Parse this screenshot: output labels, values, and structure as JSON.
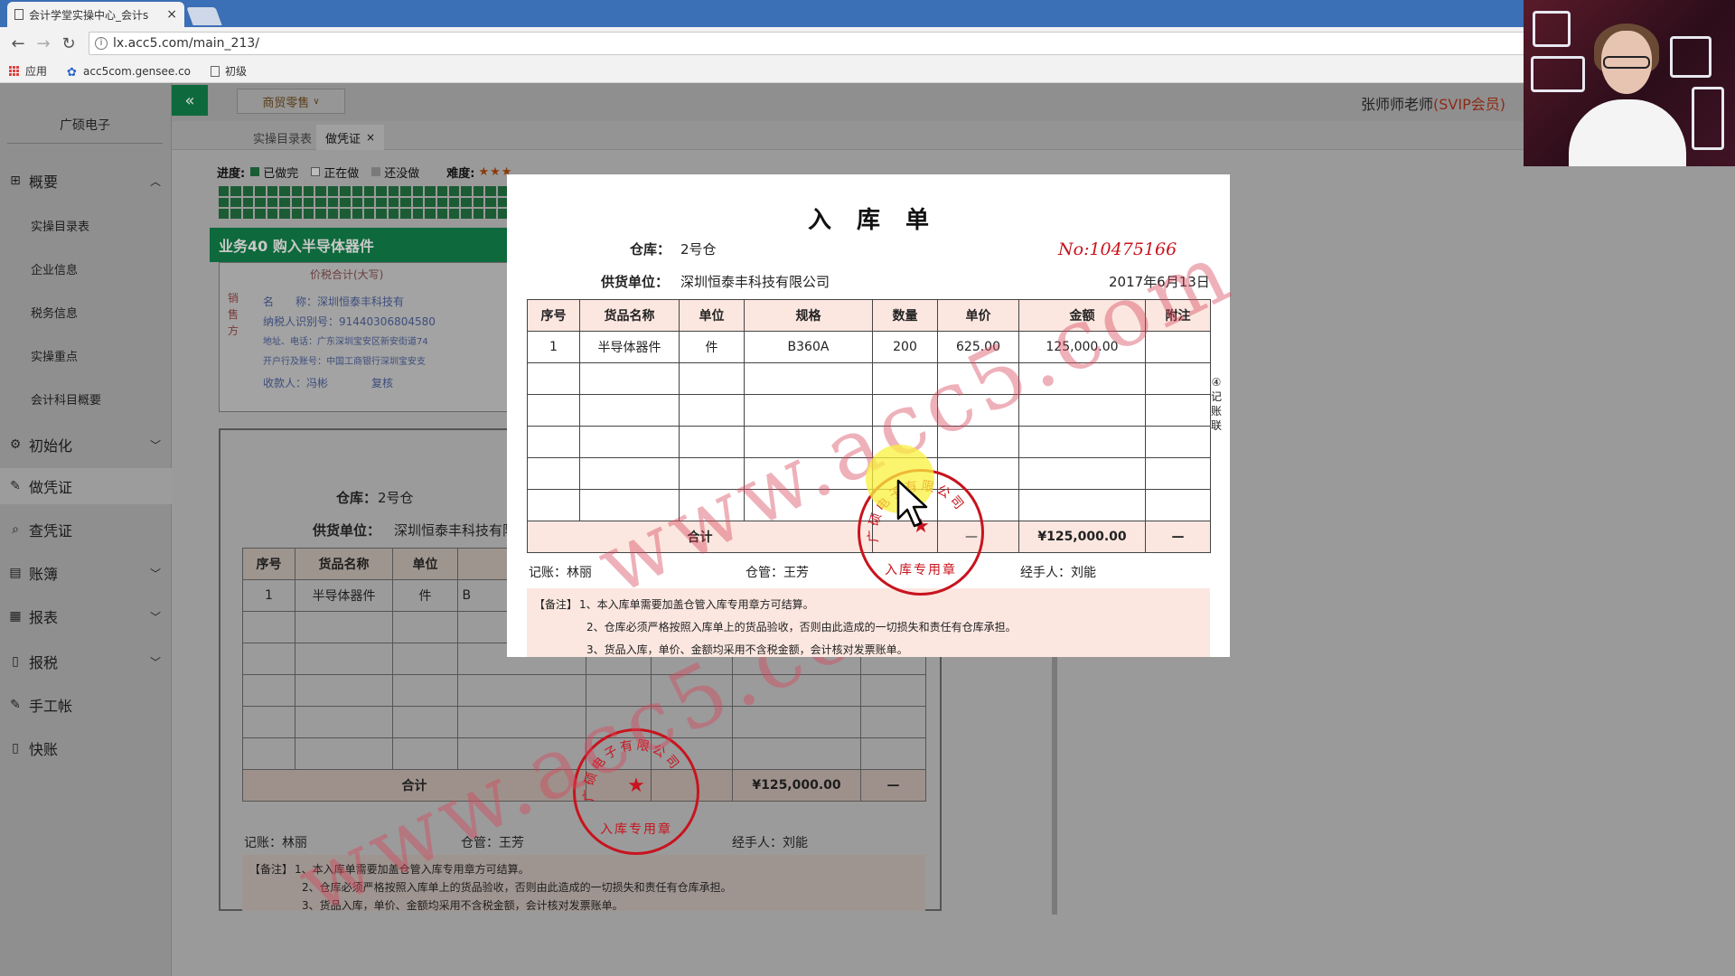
{
  "browser": {
    "tab_title": "会计学堂实操中心_会计s",
    "tab_close": "×",
    "url": "lx.acc5.com/main_213/",
    "bookmarks": [
      "应用",
      "acc5com.gensee.co",
      "初级"
    ]
  },
  "header": {
    "collapse_glyph": "«",
    "industry_select": "商贸零售",
    "teacher_name": "张师师老师",
    "teacher_badge": "(SVIP会员)"
  },
  "sidebar": {
    "company": "广硕电子",
    "items": [
      {
        "label": "概要",
        "icon": "grid-icon",
        "chevron": "up"
      },
      {
        "label": "初始化",
        "icon": "gear-icon",
        "chevron": "down"
      },
      {
        "label": "做凭证",
        "icon": "pen-icon",
        "chevron": ""
      },
      {
        "label": "查凭证",
        "icon": "search-icon",
        "chevron": ""
      },
      {
        "label": "账簿",
        "icon": "book-icon",
        "chevron": "down"
      },
      {
        "label": "报表",
        "icon": "report-icon",
        "chevron": "down"
      },
      {
        "label": "报税",
        "icon": "file-icon",
        "chevron": "down"
      },
      {
        "label": "手工帐",
        "icon": "pen-icon",
        "chevron": ""
      },
      {
        "label": "快账",
        "icon": "file-icon",
        "chevron": ""
      }
    ],
    "sub_items": [
      "实操目录表",
      "企业信息",
      "税务信息",
      "实操重点",
      "会计科目概要"
    ]
  },
  "page_tabs": [
    {
      "label": "实操目录表"
    },
    {
      "label": "做凭证",
      "close": "×"
    }
  ],
  "progress": {
    "label": "进度:",
    "legend_done": "已做完",
    "legend_doing": "正在做",
    "legend_todo": "还没做",
    "difficulty_label": "难度:",
    "difficulty_stars": "★★★"
  },
  "task": {
    "title": "业务40 购入半导体器件"
  },
  "invoice_fragment": {
    "title": "价税合计(大写)",
    "side_label": "销售方",
    "lines": [
      "名　　称：深圳恒泰丰科技有",
      "纳税人识别号：914403068045​80",
      "地址、电话：广东深圳宝安区新安街道74",
      "开户行及账号：中国工商银行深圳宝安支",
      "收款人：冯彬　　　　复核"
    ]
  },
  "receipt": {
    "title": "入库单",
    "warehouse_label": "仓库：",
    "warehouse_value": "2号仓",
    "supplier_label": "供货单位：",
    "supplier_value": "深圳恒泰丰科技有限公司",
    "number": "No:10475166",
    "date": "2017年6月13日",
    "columns": [
      "序号",
      "货品名称",
      "单位",
      "规格",
      "数量",
      "单价",
      "金额",
      "附注"
    ],
    "rows": [
      [
        "1",
        "半导体器件",
        "件",
        "B360A",
        "200",
        "625.00",
        "125,000.00",
        ""
      ],
      [
        "",
        "",
        "",
        "",
        "",
        "",
        "",
        ""
      ],
      [
        "",
        "",
        "",
        "",
        "",
        "",
        "",
        ""
      ],
      [
        "",
        "",
        "",
        "",
        "",
        "",
        "",
        ""
      ],
      [
        "",
        "",
        "",
        "",
        "",
        "",
        "",
        ""
      ],
      [
        "",
        "",
        "",
        "",
        "",
        "",
        "",
        ""
      ]
    ],
    "total_label": "合计",
    "total_qty": "—",
    "total_amount": "¥125,000.00",
    "total_note": "—",
    "side_label": "④记账联",
    "bookkeeper": "记账：林丽",
    "keeper": "仓管：王芳",
    "handler": "经手人：刘能",
    "notes_tag": "【备注】",
    "notes": [
      "1、本入库单需要加盖仓管入库专用章方可结算。",
      "2、仓库必须严格按照入库单上的货品验收，否则由此造成的一切损失和责任有仓库承担。",
      "3、货品入库，单价、金额均采用不含税金额，会计核对发票账单。"
    ],
    "stamp_text": "入库专用章",
    "stamp_arc": "广硕电子有限公司",
    "watermark": "www.acc5.com"
  },
  "colors": {
    "brand_green": "#0e6a3c",
    "stamp_red": "#c8141e",
    "number_red": "#c8141e",
    "header_pink": "#fbe7e0"
  }
}
